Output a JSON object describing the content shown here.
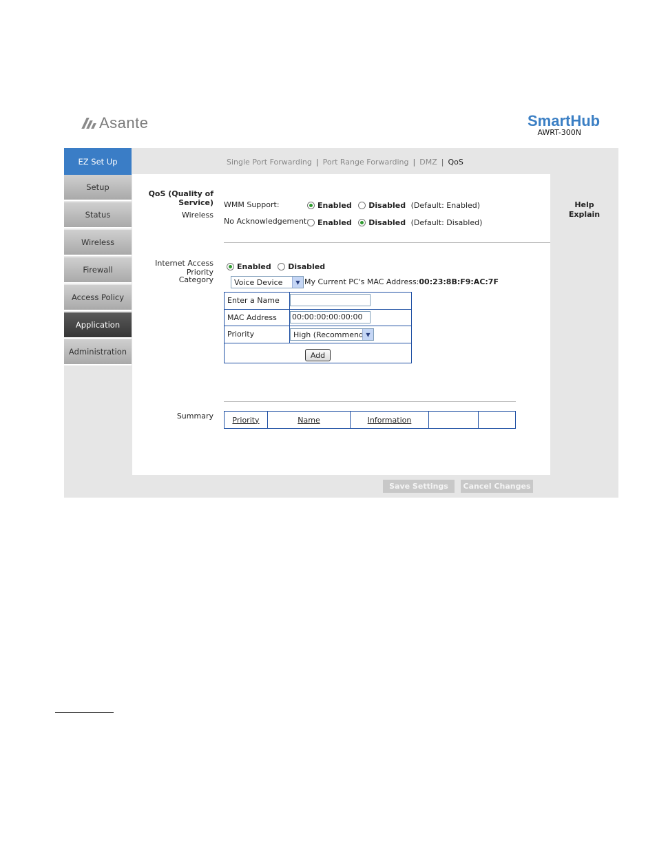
{
  "header": {
    "brand_left": "Asante",
    "brand_right": "SmartHub",
    "model": "AWRT-300N"
  },
  "sidebar": {
    "items": [
      {
        "label": "EZ Set Up"
      },
      {
        "label": "Setup"
      },
      {
        "label": "Status"
      },
      {
        "label": "Wireless"
      },
      {
        "label": "Firewall"
      },
      {
        "label": "Access Policy"
      },
      {
        "label": "Application"
      },
      {
        "label": "Administration"
      }
    ]
  },
  "subnav": {
    "items": [
      "Single Port Forwarding",
      "Port Range Forwarding",
      "DMZ",
      "QoS"
    ],
    "separator": "|"
  },
  "help": {
    "line1": "Help",
    "line2": "Explain"
  },
  "qos": {
    "section_title_1": "QoS (Quality of",
    "section_title_2": "Service)",
    "section_sub": "Wireless",
    "wmm_label": "WMM Support:",
    "wmm_enabled": "Enabled",
    "wmm_disabled": "Disabled",
    "wmm_default": "(Default: Enabled)",
    "noack_label": "No Acknowledgement:",
    "noack_enabled": "Enabled",
    "noack_disabled": "Disabled",
    "noack_default": "(Default: Disabled)"
  },
  "iap": {
    "label": "Internet Access Priority",
    "enabled": "Enabled",
    "disabled": "Disabled",
    "category_label": "Category",
    "category_value": "Voice Device",
    "mac_info_label": "My Current PC's MAC Address:",
    "mac_info_value": "00:23:8B:F9:AC:7F"
  },
  "form": {
    "name_label": "Enter a Name",
    "name_value": "",
    "mac_label": "MAC Address",
    "mac_value": "00:00:00:00:00:00",
    "priority_label": "Priority",
    "priority_value": "High (Recommend)",
    "add_label": "Add"
  },
  "summary": {
    "label": "Summary",
    "columns": [
      "Priority",
      "Name",
      "Information",
      "",
      ""
    ]
  },
  "footer": {
    "save_label": "Save Settings",
    "cancel_label": "Cancel Changes"
  }
}
